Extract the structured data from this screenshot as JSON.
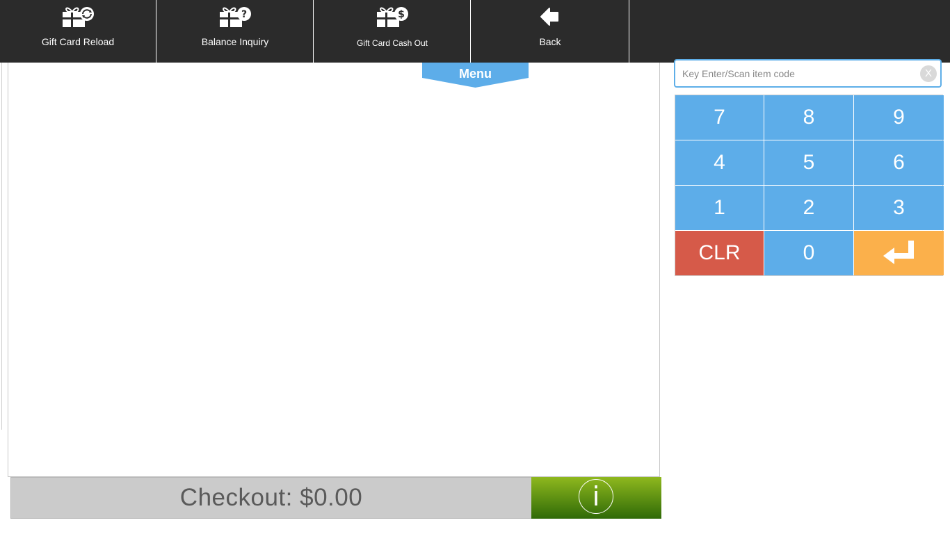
{
  "toolbar": {
    "buttons": [
      {
        "label": "Gift Card Reload",
        "icon": "gift-card-reload-icon"
      },
      {
        "label": "Balance Inquiry",
        "icon": "gift-card-question-icon"
      },
      {
        "label": "Gift Card Cash Out",
        "icon": "gift-card-dollar-icon"
      },
      {
        "label": "Back",
        "icon": "back-arrow-icon"
      }
    ]
  },
  "menu": {
    "label": "Menu"
  },
  "search": {
    "placeholder": "Key Enter/Scan item code",
    "value": "",
    "clear_label": "X"
  },
  "keypad": {
    "keys": [
      "7",
      "8",
      "9",
      "4",
      "5",
      "6",
      "1",
      "2",
      "3",
      "CLR",
      "0",
      "↵"
    ]
  },
  "checkout": {
    "label": "Checkout: $0.00",
    "info_glyph": "i"
  },
  "colors": {
    "topbar": "#2b2b2b",
    "keypad_key": "#5dade9",
    "clear_key": "#d65a49",
    "enter_key": "#fbb04b",
    "checkout_bg": "#cbcbcb",
    "info_green_top": "#8fb81e",
    "info_green_bottom": "#2f6a07"
  }
}
